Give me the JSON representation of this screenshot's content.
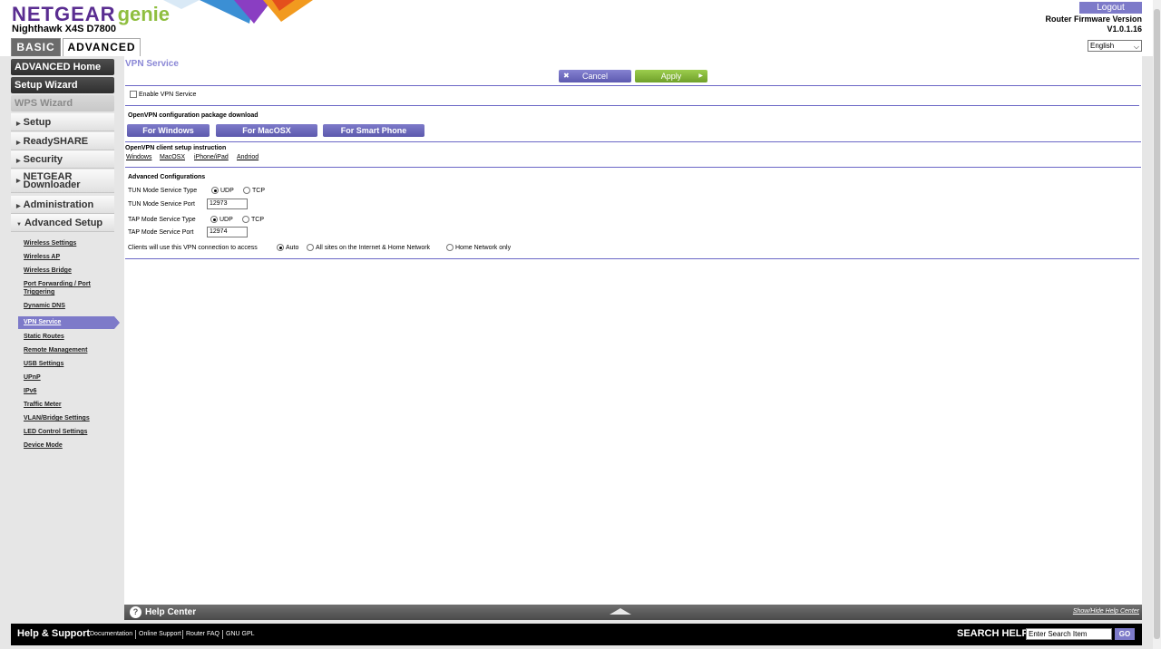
{
  "header": {
    "brand": "NETGEAR",
    "brand_suffix": "genie",
    "model": "Nighthawk X4S D7800",
    "tabs": [
      {
        "label": "BASIC"
      },
      {
        "label": "ADVANCED"
      }
    ],
    "logout_label": "Logout",
    "firmware_label": "Router Firmware Version",
    "firmware_version": "V1.0.1.16",
    "language": "English",
    "colors": {
      "brand_purple": "#5a2d91",
      "genie_green": "#8fbe3f",
      "accent": "#7d7ac9"
    }
  },
  "sidebar": {
    "main_buttons": [
      {
        "label": "ADVANCED Home"
      },
      {
        "label": "Setup Wizard"
      },
      {
        "label": "WPS Wizard"
      }
    ],
    "categories": [
      {
        "label": "Setup"
      },
      {
        "label": "ReadySHARE"
      },
      {
        "label": "Security"
      },
      {
        "label": "NETGEAR Downloader"
      },
      {
        "label": "Administration"
      },
      {
        "label": "Advanced Setup"
      }
    ],
    "advanced_items": [
      "Wireless Settings",
      "Wireless AP",
      "Wireless Bridge",
      "Port Forwarding / Port Triggering",
      "Dynamic DNS",
      "VPN Service",
      "Static Routes",
      "Remote Management",
      "USB Settings",
      "UPnP",
      "IPv6",
      "Traffic Meter",
      "VLAN/Bridge Settings",
      "LED Control Settings",
      "Device Mode"
    ],
    "active_item": "VPN Service"
  },
  "content": {
    "title": "VPN Service",
    "cancel_label": "Cancel",
    "apply_label": "Apply",
    "enable_label": "Enable VPN Service",
    "enable_checked": false,
    "package_heading": "OpenVPN configuration package download",
    "download_buttons": [
      "For Windows",
      "For MacOSX",
      "For Smart Phone"
    ],
    "client_heading": "OpenVPN client setup instruction",
    "client_links": [
      "Windows",
      "MacOSX",
      "iPhone/iPad",
      "Andriod"
    ],
    "advanced_heading": "Advanced Configurations",
    "tun_type_label": "TUN Mode Service Type",
    "tun_type_options": [
      "UDP",
      "TCP"
    ],
    "tun_type_selected": "UDP",
    "tun_port_label": "TUN Mode Service Port",
    "tun_port_value": "12973",
    "tap_type_label": "TAP Mode Service Type",
    "tap_type_options": [
      "UDP",
      "TCP"
    ],
    "tap_type_selected": "UDP",
    "tap_port_label": "TAP Mode Service Port",
    "tap_port_value": "12974",
    "access_label": "Clients will use this VPN connection to access",
    "access_options": [
      "Auto",
      "All sites on the Internet & Home Network",
      "Home Network only"
    ],
    "access_selected": "Auto"
  },
  "help_center": {
    "title": "Help Center",
    "toggle_label": "Show/Hide Help Center"
  },
  "footer": {
    "title": "Help & Support",
    "links": [
      "Documentation",
      "Online Support",
      "Router FAQ",
      "GNU GPL"
    ],
    "search_label": "SEARCH HELP",
    "search_placeholder": "Enter Search Item",
    "go_label": "GO"
  }
}
